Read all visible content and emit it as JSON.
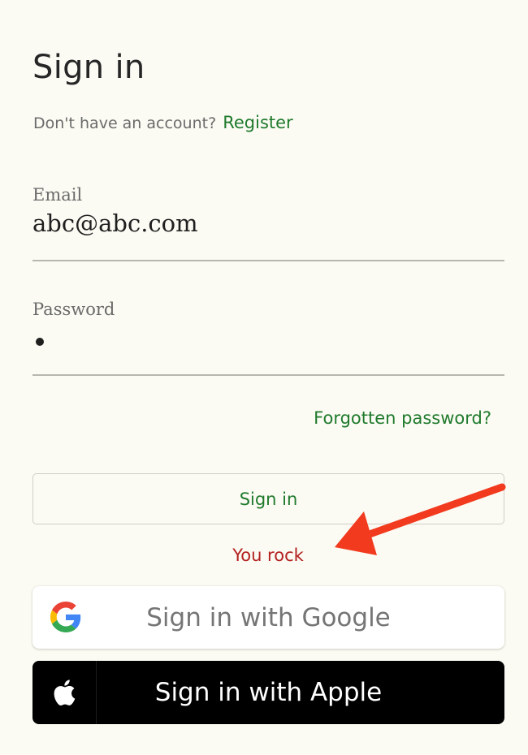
{
  "header": {
    "title": "Sign in",
    "no_account_text": "Don't have an account?",
    "register_label": "Register"
  },
  "form": {
    "email": {
      "label": "Email",
      "value": "abc@abc.com"
    },
    "password": {
      "label": "Password",
      "masked_value_length": 1
    },
    "forgot_label": "Forgotten password?",
    "submit_label": "Sign in",
    "status_message": "You rock"
  },
  "social": {
    "google_label": "Sign in with Google",
    "apple_label": "Sign in with Apple"
  },
  "icons": {
    "google": "google-icon",
    "apple": "apple-icon",
    "annotation": "red-arrow"
  },
  "colors": {
    "background": "#fbfbf3",
    "accent_green": "#1f7a2c",
    "status_red": "#b3201f",
    "arrow_red": "#f23a1e"
  }
}
